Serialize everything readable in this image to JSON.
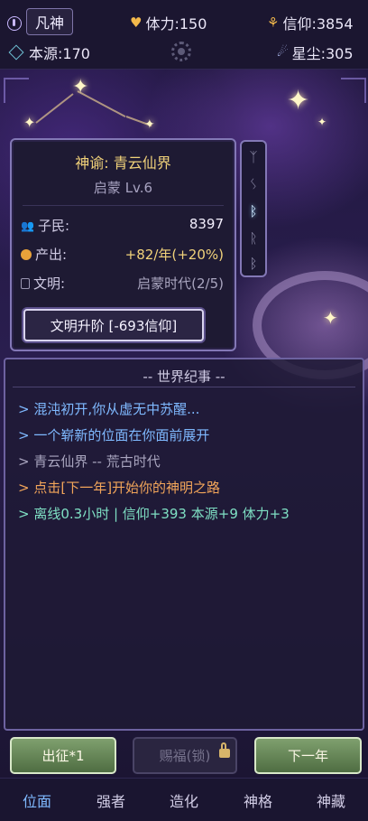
{
  "topbar": {
    "rank": "凡神",
    "stamina": "体力:150",
    "faith": "信仰:3854",
    "origin": "本源:170",
    "stardust": "星尘:305"
  },
  "info": {
    "title": "神谕: 青云仙界",
    "level": "启蒙 Lv.6",
    "rows": [
      {
        "label": "子民:",
        "value": "8397",
        "icon": "people-icon"
      },
      {
        "label": "产出:",
        "value": "+82/年(+20%)",
        "icon": "coin-icon"
      },
      {
        "label": "文明:",
        "value": "启蒙时代(2/5)",
        "icon": "book-icon"
      }
    ],
    "upgrade_label": "文明升阶 [-693信仰]"
  },
  "runes": [
    "ᛉ",
    "ᛊ",
    "ᛒ",
    "ᚱ",
    "ᛒ"
  ],
  "chronicle": {
    "header": "-- 世界纪事 --",
    "logs": [
      {
        "text": "> 混沌初开,你从虚无中苏醒...",
        "color": "#7fb9ff"
      },
      {
        "text": "> 一个崭新的位面在你面前展开",
        "color": "#7fb9ff"
      },
      {
        "text": "> 青云仙界 -- 荒古时代",
        "color": "#a9a5bf"
      },
      {
        "text": "> 点击[下一年]开始你的神明之路",
        "color": "#f2a55a"
      },
      {
        "text": "> 离线0.3小时 | 信仰+393 本源+9 体力+3",
        "color": "#7fe0c4"
      }
    ]
  },
  "actions": {
    "go": "出征*1",
    "grant": "赐福(锁)",
    "next": "下一年"
  },
  "nav": {
    "tabs": [
      "位面",
      "强者",
      "造化",
      "神格",
      "神藏"
    ],
    "active": "位面"
  },
  "colors": {
    "accent": "#7fb9ff",
    "gold": "#f1d27a",
    "green_button": "#6a8c5c"
  }
}
